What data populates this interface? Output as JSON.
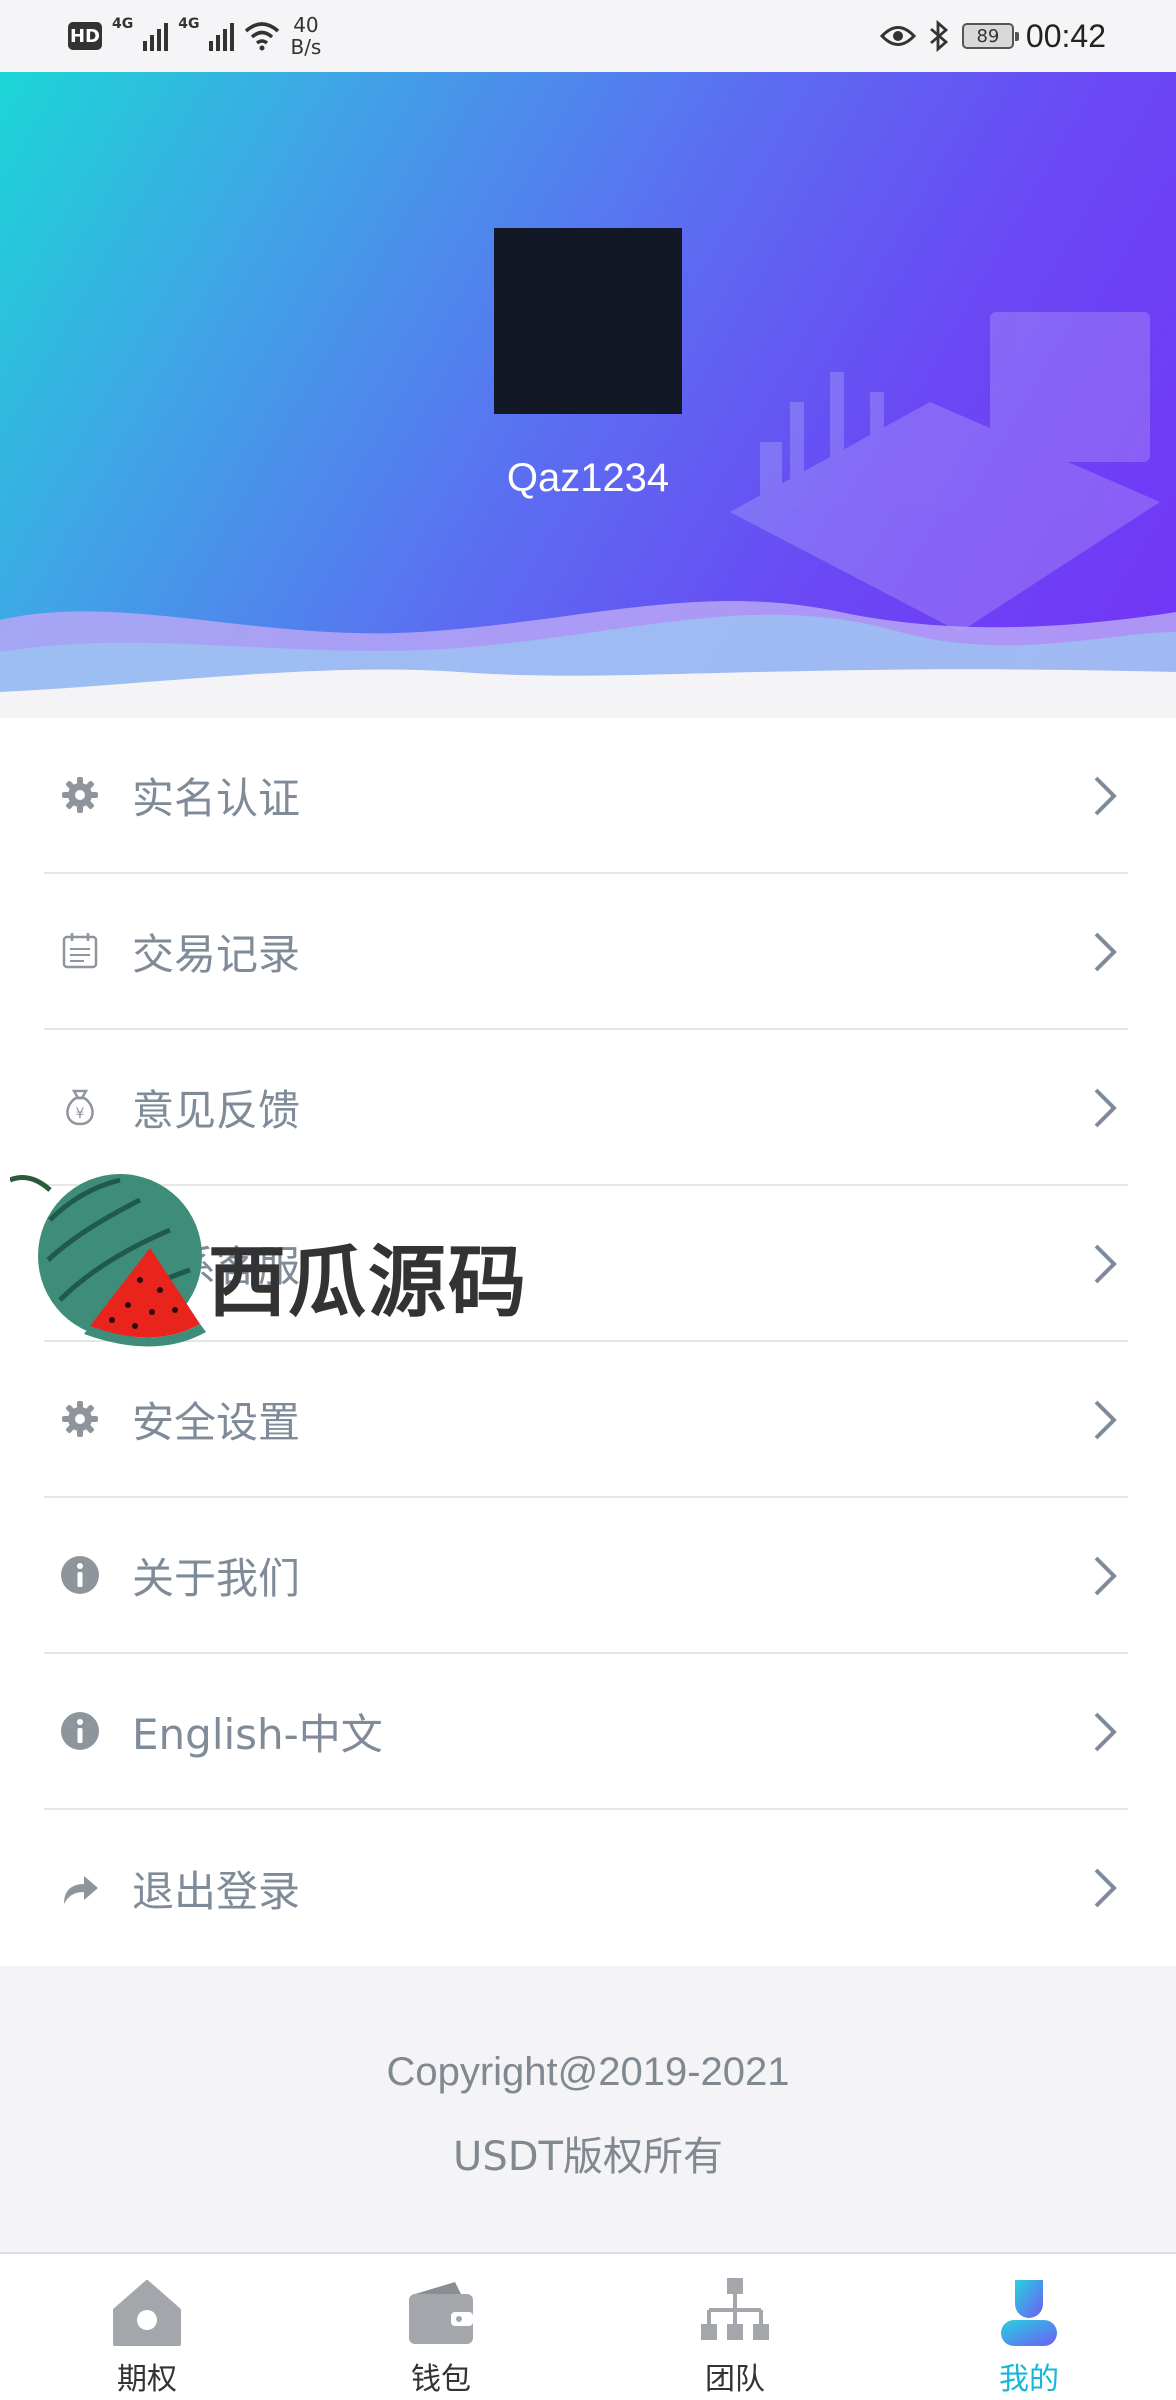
{
  "status_bar": {
    "hd": "HD",
    "net1": "4G",
    "net2": "4G",
    "speed_value": "40",
    "speed_unit": "B/s",
    "battery": "89",
    "time": "00:42",
    "icons": [
      "hd-icon",
      "signal-icon",
      "signal-icon",
      "wifi-icon",
      "eye-icon",
      "bluetooth-icon",
      "battery-icon"
    ]
  },
  "profile": {
    "username": "Qaz1234"
  },
  "menu": {
    "items": [
      {
        "label": "实名认证",
        "icon": "gear-icon"
      },
      {
        "label": "交易记录",
        "icon": "calendar-icon"
      },
      {
        "label": "意见反馈",
        "icon": "money-bag-icon"
      },
      {
        "label": "联系客服",
        "icon": "headset-icon"
      },
      {
        "label": "安全设置",
        "icon": "gear-icon"
      },
      {
        "label": "关于我们",
        "icon": "info-icon"
      },
      {
        "label": "English-中文",
        "icon": "info-icon"
      },
      {
        "label": "退出登录",
        "icon": "share-arrow-icon"
      }
    ]
  },
  "watermark": {
    "text": "西瓜源码"
  },
  "footer": {
    "copyright": "Copyright@2019-2021",
    "rights": "USDT版权所有"
  },
  "tabbar": {
    "tabs": [
      {
        "label": "期权",
        "icon": "home-icon",
        "active": false
      },
      {
        "label": "钱包",
        "icon": "wallet-icon",
        "active": false
      },
      {
        "label": "团队",
        "icon": "org-chart-icon",
        "active": false
      },
      {
        "label": "我的",
        "icon": "user-icon",
        "active": true
      }
    ]
  },
  "colors": {
    "accent": "#16b8d8",
    "banner_start": "#1bd6d6",
    "banner_end": "#7433f7",
    "label_gray": "#7f8b98"
  }
}
